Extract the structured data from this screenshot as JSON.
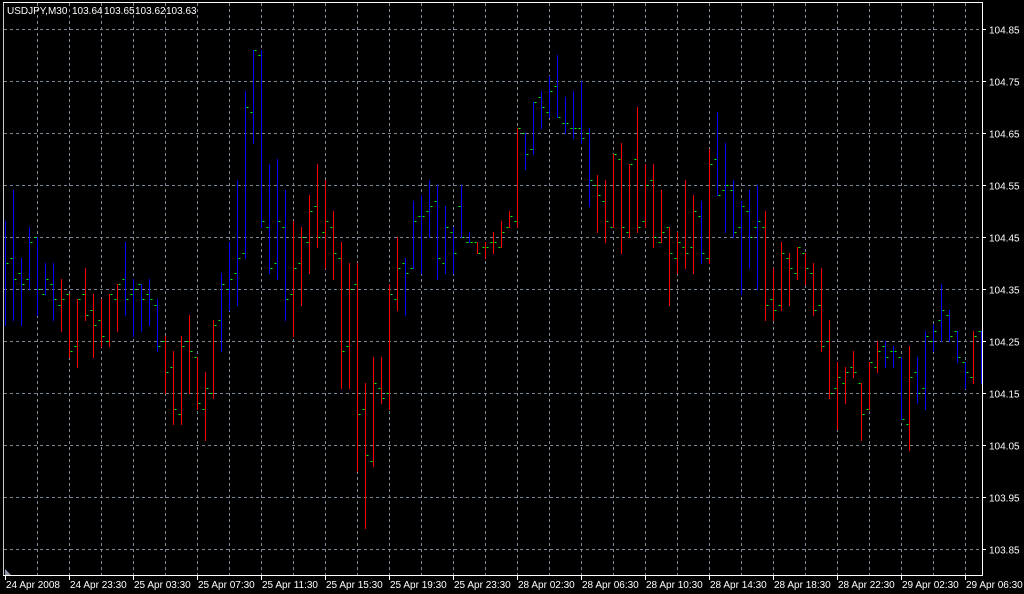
{
  "chart_data": {
    "type": "ohlc",
    "header": {
      "symbol_timeframe": "USDJPY,M30",
      "open": "103.64",
      "high": "103.65",
      "low": "103.62",
      "close": "103.63"
    },
    "ylim": [
      103.8,
      104.9
    ],
    "grid": true,
    "y_ticks": [
      "104.85",
      "104.75",
      "104.65",
      "104.55",
      "104.45",
      "104.35",
      "104.25",
      "104.15",
      "104.05",
      "103.95",
      "103.85"
    ],
    "x_tick_labels": [
      "24 Apr 2008",
      "24 Apr 23:30",
      "25 Apr 03:30",
      "25 Apr 07:30",
      "25 Apr 11:30",
      "25 Apr 15:30",
      "25 Apr 19:30",
      "25 Apr 23:30",
      "28 Apr 02:30",
      "28 Apr 06:30",
      "28 Apr 10:30",
      "28 Apr 14:30",
      "28 Apr 18:30",
      "28 Apr 22:30",
      "29 Apr 02:30",
      "29 Apr 06:30"
    ],
    "colors": {
      "background": "#000000",
      "grid": "#7a8898",
      "frame": "#ffffff",
      "bar_blue": "#0000ff",
      "bar_red": "#ff0000",
      "open_close_tick": "#00ff00"
    },
    "bar_fields": [
      "open",
      "high",
      "low",
      "close",
      "color"
    ],
    "bars": [
      [
        104.42,
        104.48,
        104.28,
        104.4,
        "blue"
      ],
      [
        104.41,
        104.54,
        104.29,
        104.37,
        "blue"
      ],
      [
        104.38,
        104.41,
        104.28,
        104.36,
        "blue"
      ],
      [
        104.37,
        104.47,
        104.35,
        104.44,
        "blue"
      ],
      [
        104.45,
        104.45,
        104.3,
        104.35,
        "blue"
      ],
      [
        104.34,
        104.4,
        104.34,
        104.37,
        "blue"
      ],
      [
        104.36,
        104.4,
        104.29,
        104.33,
        "blue"
      ],
      [
        104.32,
        104.37,
        104.27,
        104.33,
        "red"
      ],
      [
        104.34,
        104.34,
        104.22,
        104.23,
        "red"
      ],
      [
        104.24,
        104.33,
        104.2,
        104.33,
        "red"
      ],
      [
        104.34,
        104.39,
        104.29,
        104.3,
        "red"
      ],
      [
        104.31,
        104.34,
        104.22,
        104.28,
        "red"
      ],
      [
        104.29,
        104.33,
        104.24,
        104.26,
        "red"
      ],
      [
        104.25,
        104.34,
        104.24,
        104.34,
        "red"
      ],
      [
        104.33,
        104.36,
        104.27,
        104.36,
        "red"
      ],
      [
        104.37,
        104.44,
        104.3,
        104.33,
        "blue"
      ],
      [
        104.34,
        104.37,
        104.26,
        104.35,
        "blue"
      ],
      [
        104.36,
        104.36,
        104.27,
        104.33,
        "blue"
      ],
      [
        104.34,
        104.37,
        104.28,
        104.33,
        "blue"
      ],
      [
        104.32,
        104.33,
        104.23,
        104.24,
        "blue"
      ],
      [
        104.25,
        104.26,
        104.15,
        104.19,
        "red"
      ],
      [
        104.2,
        104.23,
        104.09,
        104.12,
        "red"
      ],
      [
        104.11,
        104.26,
        104.09,
        104.24,
        "red"
      ],
      [
        104.25,
        104.3,
        104.15,
        104.23,
        "red"
      ],
      [
        104.22,
        104.22,
        104.12,
        104.13,
        "red"
      ],
      [
        104.12,
        104.19,
        104.06,
        104.16,
        "red"
      ],
      [
        104.15,
        104.29,
        104.14,
        104.28,
        "red"
      ],
      [
        104.29,
        104.38,
        104.23,
        104.36,
        "blue"
      ],
      [
        104.35,
        104.44,
        104.31,
        104.37,
        "blue"
      ],
      [
        104.38,
        104.56,
        104.32,
        104.41,
        "blue"
      ],
      [
        104.42,
        104.73,
        104.41,
        104.7,
        "blue"
      ],
      [
        104.69,
        104.81,
        104.63,
        104.81,
        "blue"
      ],
      [
        104.8,
        104.81,
        104.47,
        104.48,
        "blue"
      ],
      [
        104.47,
        104.59,
        104.38,
        104.39,
        "blue"
      ],
      [
        104.4,
        104.6,
        104.37,
        104.48,
        "blue"
      ],
      [
        104.47,
        104.54,
        104.29,
        104.33,
        "blue"
      ],
      [
        104.34,
        104.48,
        104.26,
        104.39,
        "red"
      ],
      [
        104.4,
        104.47,
        104.32,
        104.45,
        "red"
      ],
      [
        104.44,
        104.53,
        104.38,
        104.5,
        "red"
      ],
      [
        104.51,
        104.59,
        104.43,
        104.45,
        "red"
      ],
      [
        104.46,
        104.56,
        104.39,
        104.48,
        "red"
      ],
      [
        104.47,
        104.5,
        104.37,
        104.42,
        "red"
      ],
      [
        104.41,
        104.44,
        104.16,
        104.23,
        "red"
      ],
      [
        104.24,
        104.4,
        104.16,
        104.35,
        "red"
      ],
      [
        104.36,
        104.4,
        104.0,
        104.11,
        "red"
      ],
      [
        104.12,
        104.17,
        103.89,
        104.03,
        "red"
      ],
      [
        104.02,
        104.22,
        104.01,
        104.17,
        "red"
      ],
      [
        104.16,
        104.22,
        104.13,
        104.14,
        "red"
      ],
      [
        104.15,
        104.36,
        104.12,
        104.34,
        "red"
      ],
      [
        104.33,
        104.45,
        104.31,
        104.39,
        "red"
      ],
      [
        104.4,
        104.41,
        104.3,
        104.38,
        "blue"
      ],
      [
        104.39,
        104.52,
        104.39,
        104.48,
        "blue"
      ],
      [
        104.49,
        104.53,
        104.38,
        104.49,
        "blue"
      ],
      [
        104.5,
        104.56,
        104.45,
        104.51,
        "blue"
      ],
      [
        104.52,
        104.55,
        104.37,
        104.41,
        "blue"
      ],
      [
        104.4,
        104.51,
        104.38,
        104.47,
        "blue"
      ],
      [
        104.46,
        104.47,
        104.38,
        104.42,
        "blue"
      ],
      [
        104.51,
        104.55,
        104.45,
        104.45,
        "blue"
      ],
      [
        104.44,
        104.46,
        104.44,
        104.44,
        "blue"
      ],
      [
        104.44,
        104.44,
        104.42,
        104.42,
        "red"
      ],
      [
        104.43,
        104.44,
        104.41,
        104.43,
        "red"
      ],
      [
        104.44,
        104.46,
        104.42,
        104.44,
        "red"
      ],
      [
        104.43,
        104.48,
        104.43,
        104.46,
        "red"
      ],
      [
        104.47,
        104.5,
        104.47,
        104.49,
        "red"
      ],
      [
        104.48,
        104.66,
        104.47,
        104.66,
        "red"
      ],
      [
        104.65,
        104.65,
        104.58,
        104.61,
        "blue"
      ],
      [
        104.62,
        104.71,
        104.61,
        104.71,
        "blue"
      ],
      [
        104.72,
        104.73,
        104.66,
        104.7,
        "blue"
      ],
      [
        104.69,
        104.76,
        104.68,
        104.73,
        "blue"
      ],
      [
        104.74,
        104.8,
        104.68,
        104.68,
        "blue"
      ],
      [
        104.67,
        104.72,
        104.65,
        104.67,
        "blue"
      ],
      [
        104.66,
        104.73,
        104.64,
        104.66,
        "blue"
      ],
      [
        104.66,
        104.75,
        104.63,
        104.64,
        "blue"
      ],
      [
        104.65,
        104.66,
        104.51,
        104.56,
        "blue"
      ],
      [
        104.55,
        104.57,
        104.46,
        104.53,
        "red"
      ],
      [
        104.52,
        104.56,
        104.44,
        104.48,
        "red"
      ],
      [
        104.47,
        104.61,
        104.47,
        104.61,
        "red"
      ],
      [
        104.6,
        104.63,
        104.42,
        104.47,
        "red"
      ],
      [
        104.46,
        104.59,
        104.45,
        104.59,
        "red"
      ],
      [
        104.6,
        104.7,
        104.46,
        104.47,
        "red"
      ],
      [
        104.48,
        104.59,
        104.47,
        104.55,
        "red"
      ],
      [
        104.56,
        104.59,
        104.43,
        104.45,
        "red"
      ],
      [
        104.44,
        104.54,
        104.44,
        104.46,
        "red"
      ],
      [
        104.47,
        104.47,
        104.32,
        104.42,
        "red"
      ],
      [
        104.41,
        104.46,
        104.38,
        104.44,
        "red"
      ],
      [
        104.43,
        104.56,
        104.39,
        104.42,
        "red"
      ],
      [
        104.43,
        104.53,
        104.38,
        104.5,
        "red"
      ],
      [
        104.49,
        104.52,
        104.4,
        104.42,
        "blue"
      ],
      [
        104.41,
        104.62,
        104.4,
        104.59,
        "red"
      ],
      [
        104.6,
        104.69,
        104.53,
        104.53,
        "blue"
      ],
      [
        104.54,
        104.63,
        104.46,
        104.55,
        "blue"
      ],
      [
        104.54,
        104.56,
        104.45,
        104.46,
        "blue"
      ],
      [
        104.47,
        104.52,
        104.34,
        104.51,
        "blue"
      ],
      [
        104.5,
        104.54,
        104.39,
        104.45,
        "blue"
      ],
      [
        104.47,
        104.55,
        104.35,
        104.48,
        "blue"
      ],
      [
        104.47,
        104.5,
        104.29,
        104.32,
        "red"
      ],
      [
        104.33,
        104.39,
        104.29,
        104.31,
        "red"
      ],
      [
        104.32,
        104.44,
        104.31,
        104.42,
        "red"
      ],
      [
        104.41,
        104.42,
        104.32,
        104.39,
        "red"
      ],
      [
        104.38,
        104.43,
        104.37,
        104.43,
        "red"
      ],
      [
        104.42,
        104.42,
        104.36,
        104.39,
        "red"
      ],
      [
        104.38,
        104.4,
        104.3,
        104.31,
        "red"
      ],
      [
        104.32,
        104.39,
        104.23,
        104.24,
        "red"
      ],
      [
        104.25,
        104.29,
        104.14,
        104.15,
        "red"
      ],
      [
        104.16,
        104.21,
        104.08,
        104.18,
        "red"
      ],
      [
        104.17,
        104.2,
        104.13,
        104.19,
        "red"
      ],
      [
        104.2,
        104.23,
        104.18,
        104.19,
        "red"
      ],
      [
        104.17,
        104.17,
        104.06,
        104.11,
        "red"
      ],
      [
        104.12,
        104.21,
        104.12,
        104.21,
        "red"
      ],
      [
        104.2,
        104.25,
        104.19,
        104.23,
        "red"
      ],
      [
        104.24,
        104.25,
        104.2,
        104.22,
        "blue"
      ],
      [
        104.23,
        104.24,
        104.2,
        104.23,
        "blue"
      ],
      [
        104.22,
        104.22,
        104.1,
        104.1,
        "blue"
      ],
      [
        104.09,
        104.24,
        104.04,
        104.18,
        "red"
      ],
      [
        104.19,
        104.22,
        104.13,
        104.15,
        "blue"
      ],
      [
        104.16,
        104.27,
        104.12,
        104.26,
        "blue"
      ],
      [
        104.25,
        104.28,
        104.23,
        104.27,
        "blue"
      ],
      [
        104.29,
        104.36,
        104.25,
        104.31,
        "blue"
      ],
      [
        104.3,
        104.31,
        104.25,
        104.26,
        "blue"
      ],
      [
        104.27,
        104.27,
        104.21,
        104.22,
        "blue"
      ],
      [
        104.21,
        104.21,
        104.16,
        104.19,
        "blue"
      ],
      [
        104.18,
        104.27,
        104.17,
        104.26,
        "red"
      ],
      [
        104.27,
        104.27,
        104.17,
        104.27,
        "blue"
      ]
    ]
  }
}
